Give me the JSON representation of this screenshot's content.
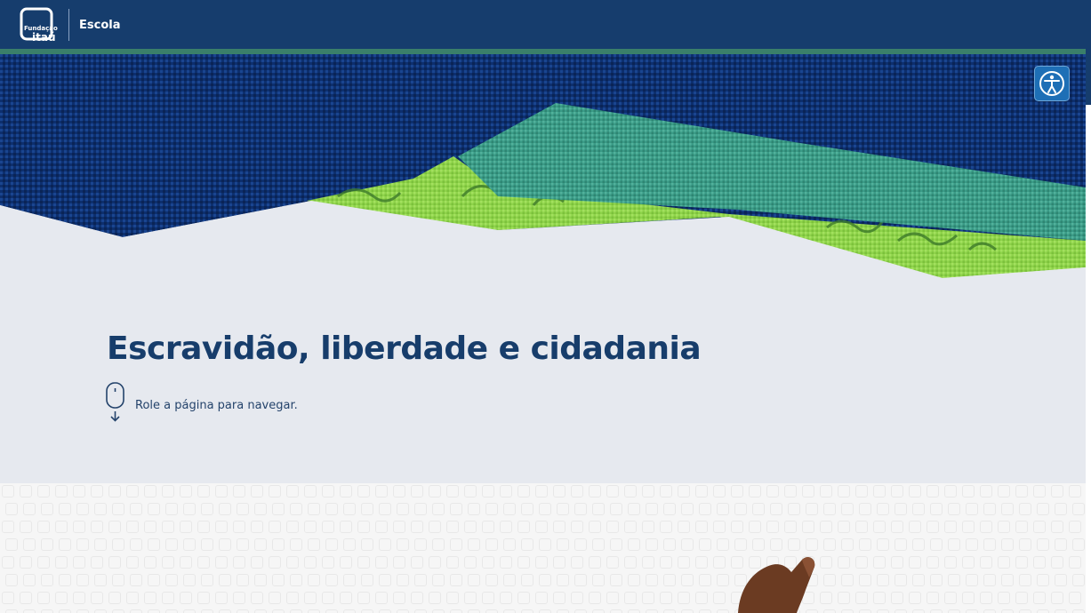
{
  "header": {
    "logo_small": "Fundação",
    "logo_big": "itaú",
    "brand_label": "Escola",
    "background": "#163d6d",
    "stripe_color": "#3a7f6a"
  },
  "accessibility": {
    "icon": "accessibility-icon",
    "color": "#1e6fb6"
  },
  "main": {
    "title": "Escravidão, liberdade e cidadania",
    "scroll_hint": "Role a página para navegar.",
    "scroll_icon": "mouse-scroll-icon"
  },
  "colors": {
    "navy": "#163d6d",
    "fabric_blue": "#0d2f6e",
    "fabric_teal": "#3a9b87",
    "fabric_green": "#8ed34a",
    "body_bg": "#e6e9ef"
  }
}
